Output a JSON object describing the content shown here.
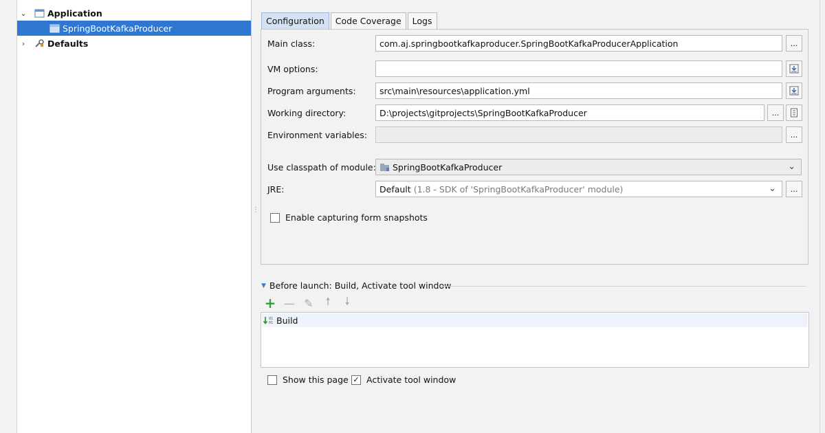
{
  "tree": {
    "items": [
      {
        "label": "Application",
        "icon": "application-config-icon",
        "expanded": true
      },
      {
        "label": "SpringBootKafkaProducer",
        "icon": "run-config-icon",
        "selected": true
      },
      {
        "label": "Defaults",
        "icon": "defaults-wrench-icon",
        "expanded": false
      }
    ]
  },
  "tabs": [
    "Configuration",
    "Code Coverage",
    "Logs"
  ],
  "form": {
    "main_class_label": "Main class:",
    "main_class_value": "com.aj.springbootkafkaproducer.SpringBootKafkaProducerApplication",
    "vm_options_label": "VM options:",
    "vm_options_value": "",
    "program_args_label": "Program arguments:",
    "program_args_value": "src\\main\\resources\\application.yml",
    "working_dir_label": "Working directory:",
    "working_dir_value": "D:\\projects\\gitprojects\\SpringBootKafkaProducer",
    "env_vars_label": "Environment variables:",
    "env_vars_value": "",
    "classpath_label": "Use classpath of module:",
    "classpath_value": "SpringBootKafkaProducer",
    "jre_label": "JRE:",
    "jre_value": "Default",
    "jre_hint": "(1.8 - SDK of 'SpringBootKafkaProducer' module)",
    "snapshot_label": "Enable capturing form snapshots",
    "snapshot_checked": false,
    "browse_label": "..."
  },
  "before_launch": {
    "title": "Before launch: Build, Activate tool window",
    "items": [
      "Build"
    ]
  },
  "footer": {
    "show_page_label": "Show this page",
    "show_page_checked": false,
    "activate_label": "Activate tool window",
    "activate_checked": true
  },
  "colors": {
    "selection": "#2f77d1",
    "active_tab": "#d4e2f4",
    "add_green": "#3a9d3a"
  }
}
